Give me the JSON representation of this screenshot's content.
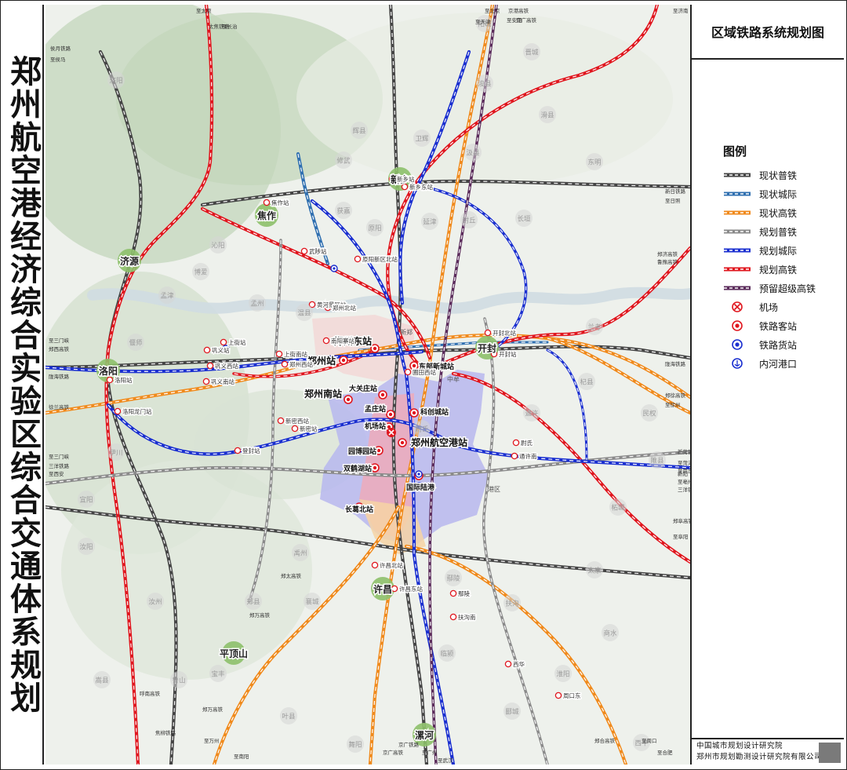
{
  "page": {
    "vertical_title": "郑州航空港经济综合实验区综合交通体系规划",
    "panel_title": "区域铁路系统规划图"
  },
  "legend": {
    "title": "图例",
    "items": [
      {
        "label": "现状普铁",
        "kind": "line",
        "color": "#444444",
        "icon": "existing-rail-line"
      },
      {
        "label": "现状城际",
        "kind": "line",
        "color": "#2f6fb0",
        "icon": "existing-intercity-line"
      },
      {
        "label": "现状高铁",
        "kind": "line",
        "color": "#f08a1c",
        "icon": "existing-hsr-line"
      },
      {
        "label": "规划普铁",
        "kind": "line",
        "color": "#8a8a8a",
        "icon": "planned-rail-line"
      },
      {
        "label": "规划城际",
        "kind": "line",
        "color": "#1a2fd0",
        "icon": "planned-intercity-line"
      },
      {
        "label": "规划高铁",
        "kind": "line",
        "color": "#e0161e",
        "icon": "planned-hsr-line"
      },
      {
        "label": "预留超级高铁",
        "kind": "line",
        "color": "#5a2a5a",
        "icon": "reserved-hyperloop-line"
      },
      {
        "label": "机场",
        "kind": "symbol",
        "color": "#e0161e",
        "icon": "airport-icon"
      },
      {
        "label": "铁路客站",
        "kind": "symbol",
        "color": "#e0161e",
        "icon": "passenger-station-icon"
      },
      {
        "label": "铁路货站",
        "kind": "symbol",
        "color": "#1a2fd0",
        "icon": "freight-station-icon"
      },
      {
        "label": "内河港口",
        "kind": "symbol",
        "color": "#1a2fd0",
        "icon": "river-port-icon"
      }
    ]
  },
  "credits": {
    "line1": "中国城市规划设计研究院",
    "line2": "郑州市规划勘测设计研究院有限公司"
  },
  "map": {
    "hub_cities": [
      {
        "name": "焦作"
      },
      {
        "name": "新乡"
      },
      {
        "name": "济源"
      },
      {
        "name": "洛阳"
      },
      {
        "name": "开封"
      },
      {
        "name": "许昌"
      },
      {
        "name": "平顶山"
      },
      {
        "name": "漯河"
      }
    ],
    "major_stations": [
      {
        "name": "郑州东站"
      },
      {
        "name": "郑州站"
      },
      {
        "name": "郑州南站"
      },
      {
        "name": "郑州航空港站"
      },
      {
        "name": "大关庄站"
      },
      {
        "name": "孟庄站"
      },
      {
        "name": "科创城站"
      },
      {
        "name": "机场站"
      },
      {
        "name": "园博园站"
      },
      {
        "name": "双鹤湖站"
      },
      {
        "name": "国际陆港"
      },
      {
        "name": "长葛北站"
      },
      {
        "name": "东部新城站"
      }
    ],
    "minor_stations": [
      {
        "name": "新乡站"
      },
      {
        "name": "新乡东站"
      },
      {
        "name": "焦作站"
      },
      {
        "name": "武陟站"
      },
      {
        "name": "原阳新区北站"
      },
      {
        "name": "黄河景区站"
      },
      {
        "name": "南阳寨站"
      },
      {
        "name": "上街南站"
      },
      {
        "name": "郑州西站"
      },
      {
        "name": "巩义站"
      },
      {
        "name": "巩义西站"
      },
      {
        "name": "巩义南站"
      },
      {
        "name": "新密西站"
      },
      {
        "name": "新密站"
      },
      {
        "name": "登封站"
      },
      {
        "name": "洛阳龙门站"
      },
      {
        "name": "洛阳站"
      },
      {
        "name": "开封北站"
      },
      {
        "name": "开封站"
      },
      {
        "name": "许昌北站"
      },
      {
        "name": "许昌东站"
      },
      {
        "name": "鄢陵"
      },
      {
        "name": "扶沟南"
      },
      {
        "name": "西华"
      },
      {
        "name": "周口东"
      },
      {
        "name": "尉氏"
      },
      {
        "name": "通许南"
      },
      {
        "name": "上街站"
      },
      {
        "name": "郑州北站"
      },
      {
        "name": "圃田西站"
      }
    ],
    "counties": [
      {
        "name": "温县"
      },
      {
        "name": "孟州"
      },
      {
        "name": "沁阳"
      },
      {
        "name": "博爱"
      },
      {
        "name": "修武"
      },
      {
        "name": "获嘉"
      },
      {
        "name": "原阳"
      },
      {
        "name": "延津"
      },
      {
        "name": "封丘"
      },
      {
        "name": "长垣"
      },
      {
        "name": "兰考"
      },
      {
        "name": "杞县"
      },
      {
        "name": "通许"
      },
      {
        "name": "太康"
      },
      {
        "name": "扶沟"
      },
      {
        "name": "鄢陵"
      },
      {
        "name": "襄城"
      },
      {
        "name": "郏县"
      },
      {
        "name": "禹州"
      },
      {
        "name": "汝州"
      },
      {
        "name": "宝丰"
      },
      {
        "name": "鲁山"
      },
      {
        "name": "叶县"
      },
      {
        "name": "舞阳"
      },
      {
        "name": "伊川"
      },
      {
        "name": "汝阳"
      },
      {
        "name": "嵩县"
      },
      {
        "name": "宜阳"
      },
      {
        "name": "孟津"
      },
      {
        "name": "偃师"
      },
      {
        "name": "辉县"
      },
      {
        "name": "卫辉"
      },
      {
        "name": "汲县"
      },
      {
        "name": "浚县"
      },
      {
        "name": "滑县"
      },
      {
        "name": "东明"
      },
      {
        "name": "民权"
      },
      {
        "name": "睢县"
      },
      {
        "name": "柘城"
      },
      {
        "name": "淮阳"
      },
      {
        "name": "临颍"
      },
      {
        "name": "郾城"
      },
      {
        "name": "商水"
      },
      {
        "name": "西平"
      },
      {
        "name": "阳城"
      },
      {
        "name": "晋城"
      },
      {
        "name": "济阳"
      },
      {
        "name": "尉氏"
      }
    ],
    "district_labels": [
      {
        "name": "港区"
      },
      {
        "name": "中牟"
      },
      {
        "name": "新郑"
      }
    ],
    "edge_labels": [
      {
        "name": "侯月铁路"
      },
      {
        "name": "至侯马"
      },
      {
        "name": "至三门峡"
      },
      {
        "name": "郑西高铁"
      },
      {
        "name": "陇海铁路"
      },
      {
        "name": "徐兰高铁"
      },
      {
        "name": "至三门峡"
      },
      {
        "name": "三洋铁路"
      },
      {
        "name": "至西安"
      },
      {
        "name": "呼南高铁"
      },
      {
        "name": "焦柳铁路"
      },
      {
        "name": "郑万高铁"
      },
      {
        "name": "至万州"
      },
      {
        "name": "至南阳"
      },
      {
        "name": "京广高铁"
      },
      {
        "name": "京广铁路"
      },
      {
        "name": "至广州"
      },
      {
        "name": "至武汉"
      },
      {
        "name": "至阜阳"
      },
      {
        "name": "郑阜高铁"
      },
      {
        "name": "新阳"
      },
      {
        "name": "至亳州"
      },
      {
        "name": "三洋铁路"
      },
      {
        "name": "至商丘"
      },
      {
        "name": "郑徐高铁"
      },
      {
        "name": "至徐州"
      },
      {
        "name": "新菏铁路"
      },
      {
        "name": "至菏泽"
      },
      {
        "name": "陇海铁路"
      },
      {
        "name": "至济南"
      },
      {
        "name": "鲁豫高铁"
      },
      {
        "name": "郑济高铁"
      },
      {
        "name": "新日铁路"
      },
      {
        "name": "至日照"
      },
      {
        "name": "至北京"
      },
      {
        "name": "京港高铁"
      },
      {
        "name": "至天津"
      },
      {
        "name": "至太原"
      },
      {
        "name": "太焦铁路"
      },
      {
        "name": "至长治"
      },
      {
        "name": "至安阳"
      },
      {
        "name": "京广高铁"
      },
      {
        "name": "至周口"
      },
      {
        "name": "郑合高铁"
      },
      {
        "name": "至合肥"
      },
      {
        "name": "郑万高铁"
      },
      {
        "name": "郑太高铁"
      }
    ]
  }
}
